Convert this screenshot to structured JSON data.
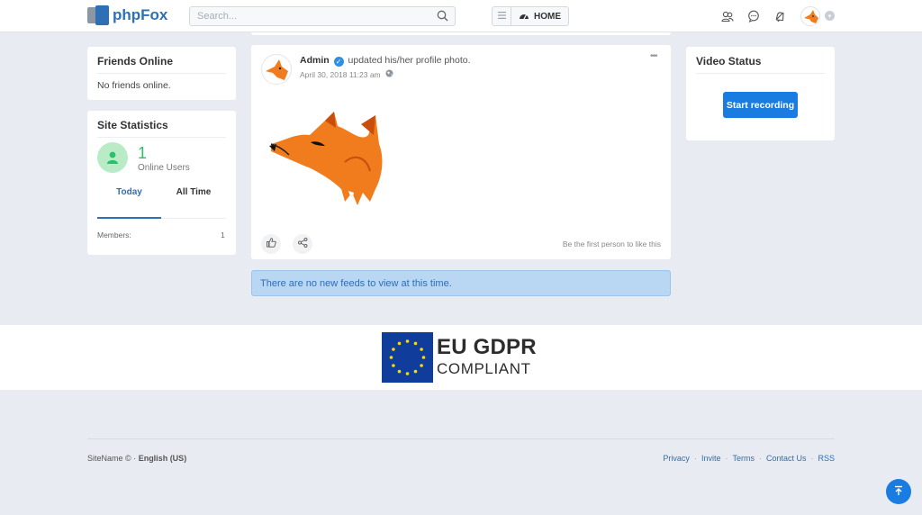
{
  "header": {
    "logo_text": "phpFox",
    "search_placeholder": "Search...",
    "home_label": "HOME"
  },
  "friends_online": {
    "title": "Friends Online",
    "empty_text": "No friends online."
  },
  "site_statistics": {
    "title": "Site Statistics",
    "online_count": "1",
    "online_label": "Online Users",
    "tabs": [
      "Today",
      "All Time"
    ],
    "active_tab": "Today",
    "rows": [
      {
        "label": "Members:",
        "value": "1"
      }
    ]
  },
  "post": {
    "author": "Admin",
    "action": "updated his/her profile photo.",
    "timestamp": "April 30, 2018 11:23 am",
    "like_prompt": "Be the first person to like this"
  },
  "feed_notice": "There are no new feeds to view at this time.",
  "video_status": {
    "title": "Video Status",
    "button_label": "Start recording"
  },
  "gdpr": {
    "line1": "EU GDPR",
    "line2": "COMPLIANT"
  },
  "footer": {
    "site_name": "SiteName ©",
    "separator": "·",
    "language": "English (US)",
    "links": [
      "Privacy",
      "Invite",
      "Terms",
      "Contact Us",
      "RSS"
    ]
  },
  "colors": {
    "brand": "#2f6fb5",
    "button": "#1a7ce0",
    "online_green": "#2cbf6a",
    "background": "#e8ebf1"
  }
}
